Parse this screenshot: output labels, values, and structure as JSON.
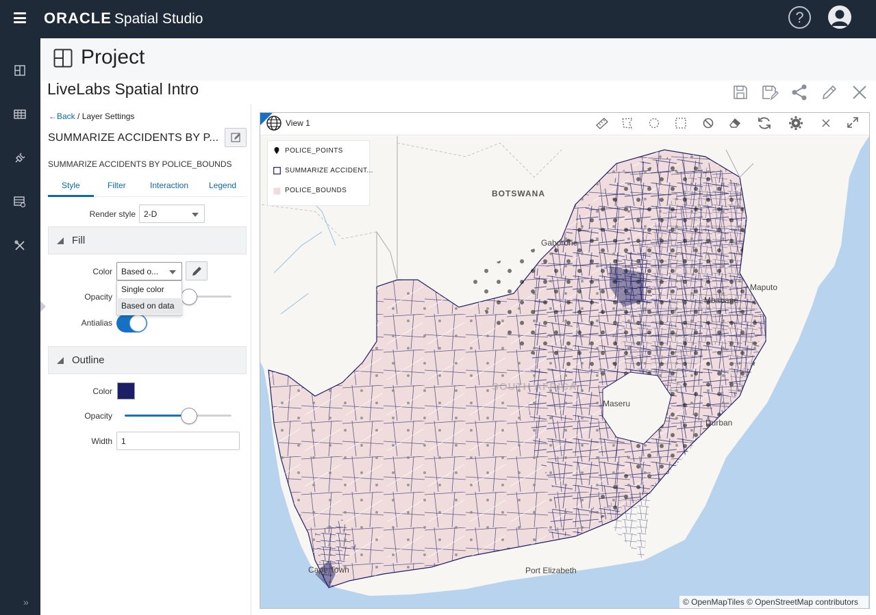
{
  "app": {
    "brand_oracle": "ORACLE",
    "brand_product": "Spatial Studio",
    "help_glyph": "?",
    "colors": {
      "topbar": "#1f2a38",
      "accent": "#0b6aa6",
      "slider": "#1771c2",
      "outline_color": "#1c1f66"
    }
  },
  "sidebar": {
    "items": [
      {
        "icon": "dashboard-icon"
      },
      {
        "icon": "table-icon"
      },
      {
        "icon": "plug-connection-icon"
      },
      {
        "icon": "dataset-icon"
      },
      {
        "icon": "tools-icon"
      }
    ],
    "collapse_glyph": "»"
  },
  "header": {
    "section_title": "Project",
    "project_name": "LiveLabs Spatial Intro",
    "actions": [
      {
        "icon": "save-icon"
      },
      {
        "icon": "save-as-icon"
      },
      {
        "icon": "share-icon"
      },
      {
        "icon": "edit-icon"
      },
      {
        "icon": "close-icon"
      }
    ]
  },
  "layer_settings": {
    "breadcrumb_back": "Back",
    "breadcrumb_current": "/ Layer Settings",
    "title": "SUMMARIZE ACCIDENTS BY P...",
    "subtitle": "SUMMARIZE ACCIDENTS BY POLICE_BOUNDS",
    "tabs": [
      {
        "label": "Style",
        "active": true
      },
      {
        "label": "Filter",
        "active": false
      },
      {
        "label": "Interaction",
        "active": false
      },
      {
        "label": "Legend",
        "active": false
      }
    ],
    "render_style_label": "Render style",
    "render_style_value": "2-D",
    "fill": {
      "header": "Fill",
      "color_label": "Color",
      "color_value": "Based o...",
      "color_options": [
        "Single color",
        "Based on data"
      ],
      "selected_option": "Based on data",
      "opacity_label": "Opacity",
      "opacity_value": 0.6,
      "antialias_label": "Antialias",
      "antialias_on": true
    },
    "outline": {
      "header": "Outline",
      "color_label": "Color",
      "color_value": "#1c1f66",
      "opacity_label": "Opacity",
      "opacity_value": 0.6,
      "width_label": "Width",
      "width_value": "1"
    }
  },
  "map_view": {
    "title": "View 1",
    "tools": [
      {
        "icon": "measure-ruler-icon"
      },
      {
        "icon": "polygon-select-icon"
      },
      {
        "icon": "circle-select-icon"
      },
      {
        "icon": "rectangle-select-icon"
      },
      {
        "icon": "clear-selection-icon"
      },
      {
        "icon": "eraser-icon"
      },
      {
        "icon": "refresh-icon"
      },
      {
        "icon": "settings-gear-icon"
      },
      {
        "icon": "close-icon"
      },
      {
        "icon": "expand-icon"
      }
    ],
    "legend": [
      {
        "label": "POLICE_POINTS",
        "symbol": "marker-icon"
      },
      {
        "label": "SUMMARIZE ACCIDENT...",
        "symbol": "square-outline-icon"
      },
      {
        "label": "POLICE_BOUNDS",
        "symbol": "square-fill-icon"
      }
    ],
    "place_labels": [
      "BOTSWANA",
      "Gaborone",
      "Maputo",
      "Mbabane",
      "Maseru",
      "Durban",
      "Cape Town",
      "Port Elizabeth",
      "SOUTH AFRICA"
    ],
    "attribution": "© OpenMapTiles  © OpenStreetMap contributors",
    "colors": {
      "water": "#b8d3ee",
      "land": "#f7f6f3",
      "region_fill": "#f0dcdc",
      "boundary": "#1c1f66"
    }
  }
}
